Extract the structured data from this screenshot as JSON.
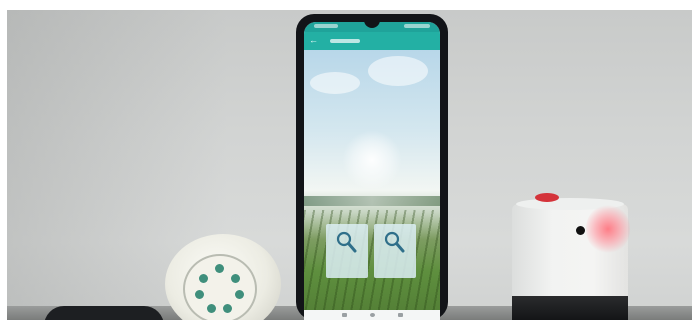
{
  "scene": {
    "description_colors": {
      "wall": "#d2d4d3",
      "table": "#8a8c8b",
      "phone_body": "#121418",
      "app_bar": "#23b0a4",
      "red_indicator": "#d4333a"
    }
  },
  "phone": {
    "app": {
      "back_icon": "arrow-left-icon",
      "search_buttons": [
        "search-icon",
        "search-icon"
      ]
    }
  },
  "devices": {
    "disc_device": {
      "led_count": 7
    },
    "cube_device": {
      "indicator": "red-light"
    }
  }
}
